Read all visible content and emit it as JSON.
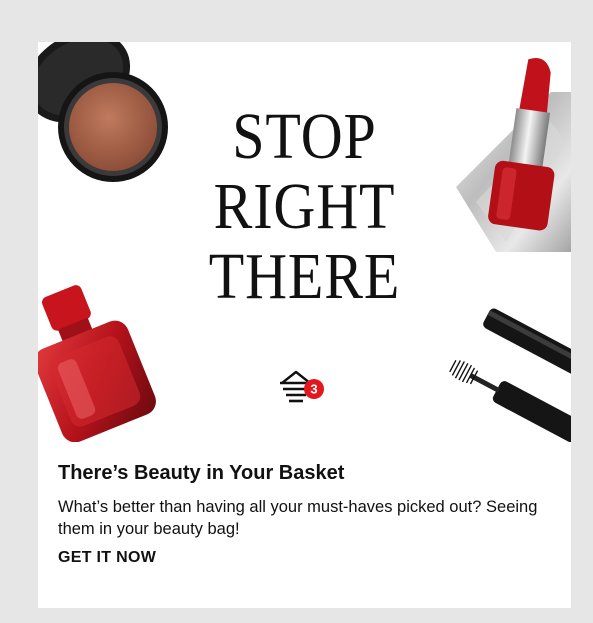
{
  "hero": {
    "headline_lines": [
      "STOP",
      "RIGHT",
      "THERE"
    ],
    "basket_count": "3"
  },
  "content": {
    "title": "There’s Beauty in Your Basket",
    "description": "What’s better than having all your must-haves picked out? Seeing them in your beauty bag!",
    "cta_label": "GET IT NOW"
  },
  "colors": {
    "accent_red": "#e1191e",
    "page_background": "#e6e6e6",
    "card_background": "#ffffff"
  },
  "icons": [
    "bronzer-compact-image",
    "perfume-bottle-image",
    "lipstick-image",
    "mascara-image",
    "beauty-bag-icon"
  ]
}
